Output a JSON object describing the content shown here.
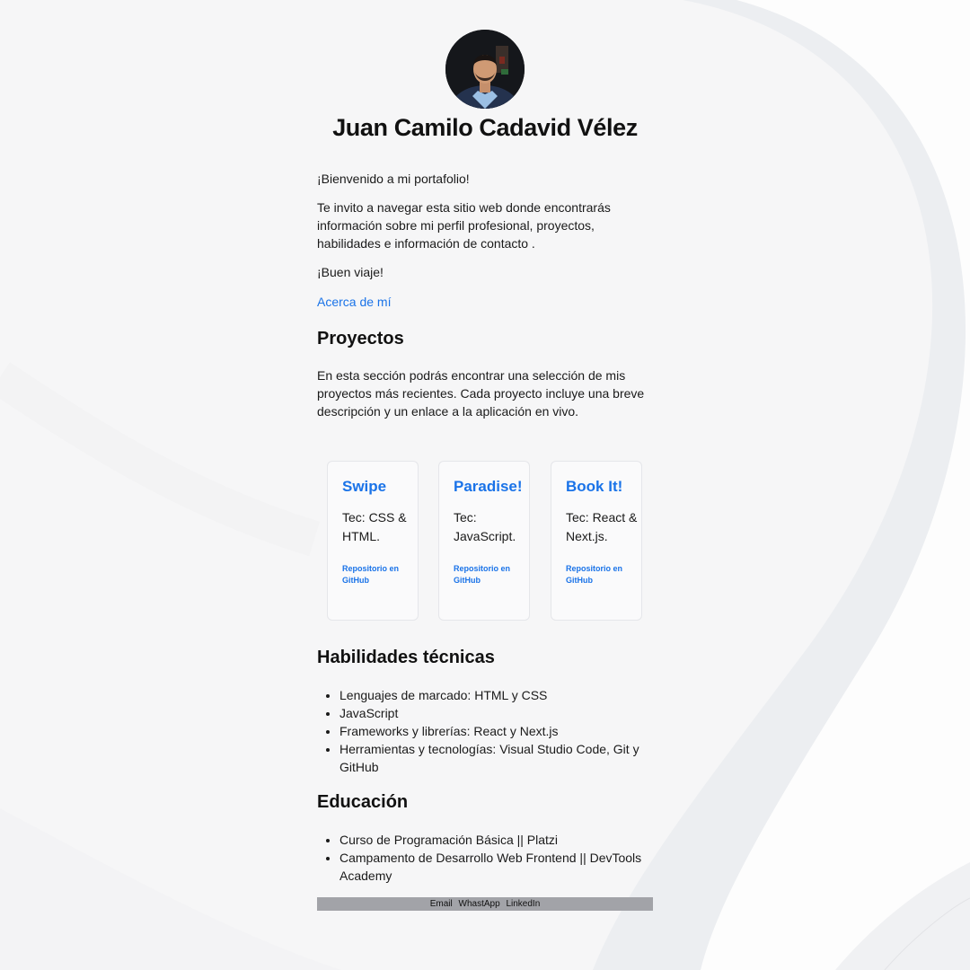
{
  "header": {
    "name": "Juan Camilo Cadavid Vélez"
  },
  "intro": {
    "welcome": "¡Bienvenido a mi portafolio!",
    "body": "Te invito a navegar esta sitio web donde encontrarás información sobre mi perfil profesional, proyectos, habilidades e información de contacto .",
    "farewell": "¡Buen viaje!",
    "about_link": "Acerca de mí"
  },
  "projects": {
    "title": "Proyectos",
    "description": "En esta sección podrás encontrar una selección de mis proyectos más recientes. Cada proyecto incluye una breve descripción y un enlace a la aplicación en vivo.",
    "items": [
      {
        "name": "Swipe",
        "tech": "Tec: CSS & HTML.",
        "repo_label": "Repositorio en GitHub"
      },
      {
        "name": "Paradise!",
        "tech": "Tec: JavaScript.",
        "repo_label": "Repositorio en GitHub"
      },
      {
        "name": "Book It!",
        "tech": "Tec: React & Next.js.",
        "repo_label": "Repositorio en GitHub"
      }
    ]
  },
  "skills": {
    "title": "Habilidades técnicas",
    "items": [
      "Lenguajes de marcado: HTML y CSS",
      "JavaScript",
      "Frameworks y librerías: React y Next.js",
      "Herramientas y tecnologías: Visual Studio Code, Git y GitHub"
    ]
  },
  "education": {
    "title": "Educación",
    "items": [
      "Curso de Programación Básica || Platzi",
      "Campamento de Desarrollo Web Frontend || DevTools Academy"
    ]
  },
  "footer": {
    "links": [
      "Email",
      "WhastApp",
      "LinkedIn"
    ]
  },
  "colors": {
    "link": "#1a73e8",
    "footer_bg": "#a2a3a8"
  }
}
